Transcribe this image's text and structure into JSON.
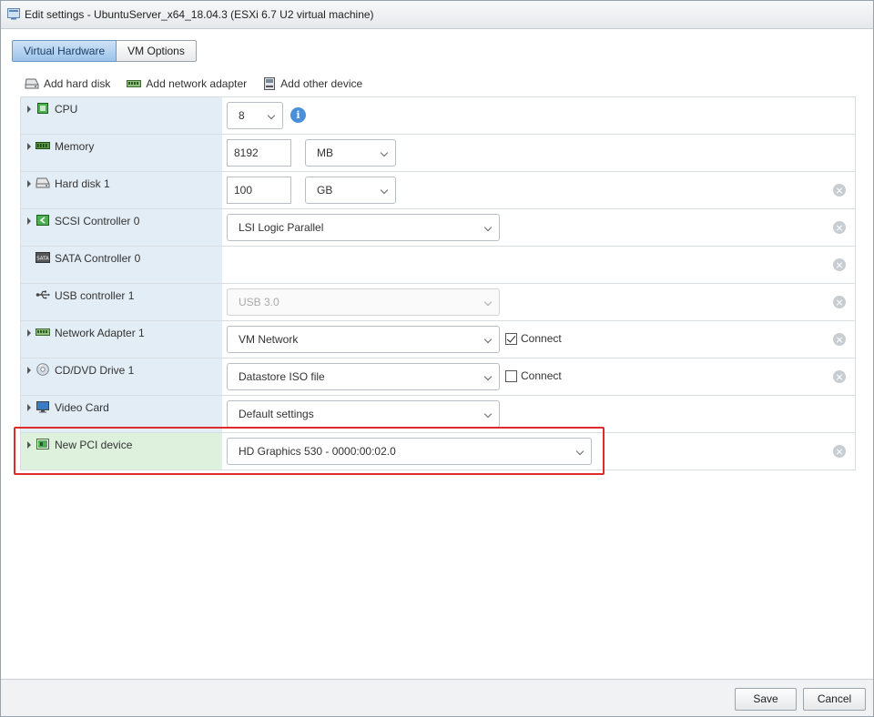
{
  "window": {
    "title": "Edit settings - UbuntuServer_x64_18.04.3 (ESXi 6.7 U2 virtual machine)"
  },
  "tabs": [
    {
      "label": "Virtual Hardware",
      "active": true
    },
    {
      "label": "VM Options",
      "active": false
    }
  ],
  "toolbar": {
    "add_hard_disk": "Add hard disk",
    "add_network_adapter": "Add network adapter",
    "add_other_device": "Add other device"
  },
  "devices": {
    "cpu": {
      "label": "CPU",
      "value": "8",
      "icon": "cpu-icon"
    },
    "memory": {
      "label": "Memory",
      "value": "8192",
      "unit": "MB",
      "icon": "memory-icon"
    },
    "hard_disk_1": {
      "label": "Hard disk 1",
      "value": "100",
      "unit": "GB",
      "icon": "hard-disk-icon"
    },
    "scsi_controller_0": {
      "label": "SCSI Controller 0",
      "value": "LSI Logic Parallel",
      "icon": "scsi-icon"
    },
    "sata_controller_0": {
      "label": "SATA Controller 0",
      "icon": "sata-icon"
    },
    "usb_controller_1": {
      "label": "USB controller 1",
      "value": "USB 3.0",
      "icon": "usb-icon",
      "disabled": true
    },
    "network_adapter_1": {
      "label": "Network Adapter 1",
      "value": "VM Network",
      "connect_label": "Connect",
      "connected": true,
      "icon": "network-adapter-icon"
    },
    "cd_dvd_drive_1": {
      "label": "CD/DVD Drive 1",
      "value": "Datastore ISO file",
      "connect_label": "Connect",
      "connected": false,
      "icon": "cd-dvd-icon"
    },
    "video_card": {
      "label": "Video Card",
      "value": "Default settings",
      "icon": "video-card-icon"
    },
    "new_pci_device": {
      "label": "New PCI device",
      "value": "HD Graphics 530 - 0000:00:02.0",
      "icon": "pci-device-icon",
      "highlighted": true
    }
  },
  "footer": {
    "save_label": "Save",
    "cancel_label": "Cancel"
  },
  "colors": {
    "label_bg": "#e3edf5",
    "pci_label_bg": "#ddf1dd",
    "highlight_border": "#e02b2b",
    "active_tab": "#9cc3ea",
    "info_blue": "#4a90d9"
  }
}
